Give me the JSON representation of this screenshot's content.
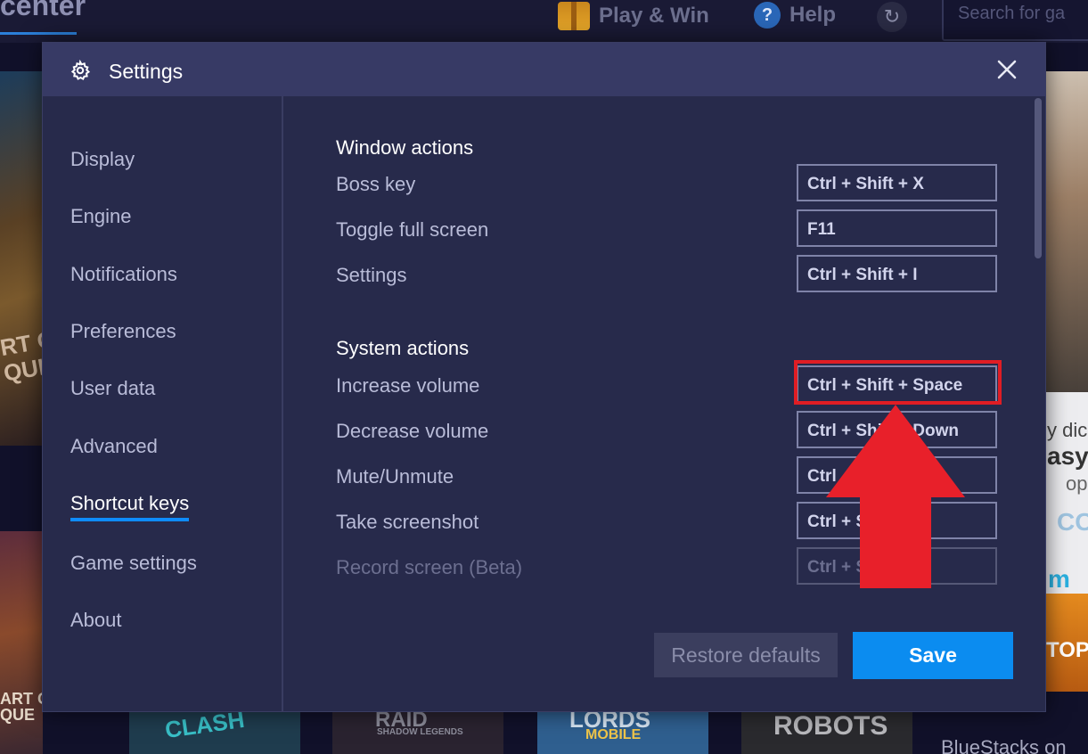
{
  "background": {
    "app_title_fragment": "center",
    "play_win_label": "Play & Win",
    "help_label": "Help",
    "search_placeholder": "Search for ga",
    "card_texts": [
      "ART OF",
      "QUE",
      "RT O",
      "QUI",
      "CLASH",
      "RAID",
      "SHADOW LEGENDS",
      "LORDS",
      "MOBILE",
      "ROBOTS",
      "BlueStacks on",
      "y dic",
      "asy",
      "op",
      "CO",
      "m",
      "TOP"
    ]
  },
  "dialog": {
    "title": "Settings",
    "sidebar": {
      "items": [
        {
          "label": "Display",
          "active": false
        },
        {
          "label": "Engine",
          "active": false
        },
        {
          "label": "Notifications",
          "active": false
        },
        {
          "label": "Preferences",
          "active": false
        },
        {
          "label": "User data",
          "active": false
        },
        {
          "label": "Advanced",
          "active": false
        },
        {
          "label": "Shortcut keys",
          "active": true
        },
        {
          "label": "Game settings",
          "active": false
        },
        {
          "label": "About",
          "active": false
        }
      ]
    },
    "sections": [
      {
        "title": "Window actions",
        "rows": [
          {
            "label": "Boss key",
            "keys": "Ctrl + Shift + X"
          },
          {
            "label": "Toggle full screen",
            "keys": "F11"
          },
          {
            "label": "Settings",
            "keys": "Ctrl + Shift + I"
          }
        ]
      },
      {
        "title": "System actions",
        "rows": [
          {
            "label": "Increase volume",
            "keys": "Ctrl + Shift + Space"
          },
          {
            "label": "Decrease volume",
            "keys": "Ctrl + Shift + Down"
          },
          {
            "label": "Mute/Unmute",
            "keys": "Ctrl"
          },
          {
            "label": "Take screenshot",
            "keys": "Ctrl + S"
          },
          {
            "label": "Record screen (Beta)",
            "keys": "Ctrl + S"
          }
        ]
      }
    ],
    "buttons": {
      "restore": "Restore defaults",
      "save": "Save"
    }
  },
  "colors": {
    "accent": "#0b8cf0",
    "highlight": "#e01d24",
    "dialog_bg": "#272a4b"
  }
}
